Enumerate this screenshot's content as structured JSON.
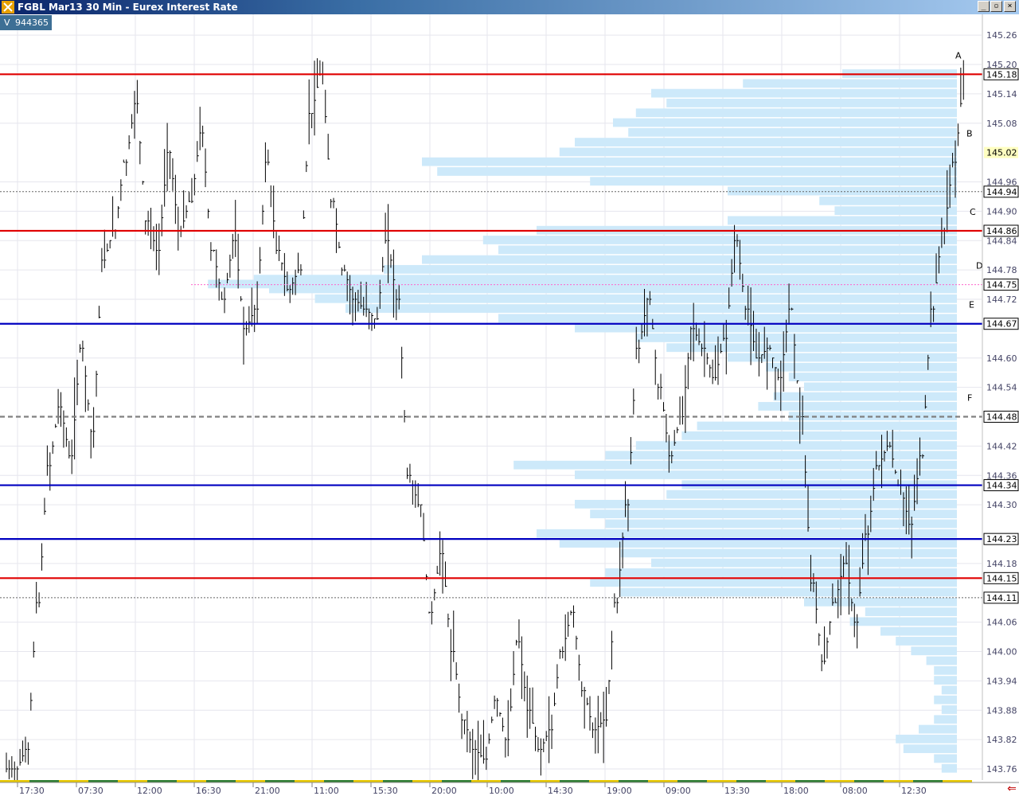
{
  "window": {
    "title": "FGBL Mar13 30 Min - Eurex Interest Rate",
    "buttons": [
      "_",
      "▫",
      "×"
    ]
  },
  "volume": {
    "label": "V",
    "value": "944365"
  },
  "colors": {
    "profile": "#cde9fa",
    "red_line": "#e00000",
    "blue_line": "#0000c0",
    "magenta_line": "#ff66cc",
    "bars": "#000000",
    "grid": "#e6e6ee",
    "session_green": "#2e7d32",
    "session_yellow": "#e8c800",
    "scroll_arrow": "#c00000"
  },
  "chart_data": {
    "type": "bar",
    "instrument": "FGBL Mar13",
    "interval": "30 Min",
    "ylim": [
      143.73,
      145.3
    ],
    "y_ticks": [
      "145.26",
      "145.20",
      "145.14",
      "145.08",
      "144.96",
      "144.90",
      "144.84",
      "144.78",
      "144.72",
      "144.60",
      "144.54",
      "144.42",
      "144.36",
      "144.30",
      "144.18",
      "144.06",
      "144.00",
      "143.94",
      "143.88",
      "143.82",
      "143.76"
    ],
    "x_ticks": [
      "17:30",
      "07:30",
      "12:00",
      "16:30",
      "21:00",
      "11:00",
      "15:30",
      "20:00",
      "10:00",
      "14:30",
      "19:00",
      "09:00",
      "13:30",
      "18:00",
      "08:00",
      "12:30"
    ],
    "price_series": {
      "name": "FGBL close",
      "values": [
        143.76,
        143.8,
        144.1,
        144.38,
        144.5,
        144.4,
        144.62,
        144.45,
        144.8,
        144.86,
        145.0,
        145.12,
        144.88,
        144.82,
        145.02,
        144.86,
        144.92,
        145.06,
        144.82,
        144.72,
        144.84,
        144.66,
        144.7,
        145.0,
        144.82,
        144.74,
        144.78,
        145.1,
        145.18,
        144.92,
        144.78,
        144.72,
        144.7,
        144.68,
        144.84,
        144.72,
        144.36,
        144.3,
        144.08,
        144.2,
        144.0,
        143.86,
        143.8,
        143.78,
        143.9,
        143.82,
        144.02,
        143.88,
        143.8,
        143.84,
        144.0,
        144.08,
        143.92,
        143.84,
        143.86,
        144.1,
        144.3,
        144.62,
        144.72,
        144.54,
        144.4,
        144.48,
        144.66,
        144.62,
        144.56,
        144.64,
        144.84,
        144.7,
        144.6,
        144.62,
        144.56,
        144.7,
        144.48,
        144.14,
        143.98,
        144.1,
        144.18,
        144.06,
        144.24,
        144.38,
        144.42,
        144.34,
        144.26,
        144.4,
        144.7,
        144.86,
        145.0,
        145.18
      ]
    },
    "profile": {
      "description": "volume-at-price histogram, relative length 0..1 per 0.01 price level",
      "levels": [
        {
          "price": 145.18,
          "rel": 0.15
        },
        {
          "price": 145.16,
          "rel": 0.28
        },
        {
          "price": 145.14,
          "rel": 0.4
        },
        {
          "price": 145.12,
          "rel": 0.38
        },
        {
          "price": 145.1,
          "rel": 0.42
        },
        {
          "price": 145.08,
          "rel": 0.45
        },
        {
          "price": 145.06,
          "rel": 0.43
        },
        {
          "price": 145.04,
          "rel": 0.5
        },
        {
          "price": 145.02,
          "rel": 0.52
        },
        {
          "price": 145.0,
          "rel": 0.7
        },
        {
          "price": 144.98,
          "rel": 0.68
        },
        {
          "price": 144.96,
          "rel": 0.48
        },
        {
          "price": 144.94,
          "rel": 0.3
        },
        {
          "price": 144.92,
          "rel": 0.18
        },
        {
          "price": 144.9,
          "rel": 0.16
        },
        {
          "price": 144.88,
          "rel": 0.3
        },
        {
          "price": 144.86,
          "rel": 0.55
        },
        {
          "price": 144.84,
          "rel": 0.62
        },
        {
          "price": 144.82,
          "rel": 0.6
        },
        {
          "price": 144.8,
          "rel": 0.7
        },
        {
          "price": 144.78,
          "rel": 0.75
        },
        {
          "price": 144.76,
          "rel": 0.92
        },
        {
          "price": 144.75,
          "rel": 0.98
        },
        {
          "price": 144.74,
          "rel": 0.9
        },
        {
          "price": 144.72,
          "rel": 0.84
        },
        {
          "price": 144.7,
          "rel": 0.8
        },
        {
          "price": 144.68,
          "rel": 0.6
        },
        {
          "price": 144.66,
          "rel": 0.5
        },
        {
          "price": 144.64,
          "rel": 0.42
        },
        {
          "price": 144.62,
          "rel": 0.38
        },
        {
          "price": 144.6,
          "rel": 0.3
        },
        {
          "price": 144.58,
          "rel": 0.25
        },
        {
          "price": 144.56,
          "rel": 0.22
        },
        {
          "price": 144.54,
          "rel": 0.2
        },
        {
          "price": 144.52,
          "rel": 0.24
        },
        {
          "price": 144.5,
          "rel": 0.26
        },
        {
          "price": 144.48,
          "rel": 0.22
        },
        {
          "price": 144.46,
          "rel": 0.34
        },
        {
          "price": 144.44,
          "rel": 0.36
        },
        {
          "price": 144.42,
          "rel": 0.42
        },
        {
          "price": 144.4,
          "rel": 0.46
        },
        {
          "price": 144.38,
          "rel": 0.58
        },
        {
          "price": 144.36,
          "rel": 0.5
        },
        {
          "price": 144.34,
          "rel": 0.36
        },
        {
          "price": 144.32,
          "rel": 0.38
        },
        {
          "price": 144.3,
          "rel": 0.5
        },
        {
          "price": 144.28,
          "rel": 0.48
        },
        {
          "price": 144.26,
          "rel": 0.46
        },
        {
          "price": 144.24,
          "rel": 0.55
        },
        {
          "price": 144.22,
          "rel": 0.52
        },
        {
          "price": 144.2,
          "rel": 0.44
        },
        {
          "price": 144.18,
          "rel": 0.4
        },
        {
          "price": 144.16,
          "rel": 0.46
        },
        {
          "price": 144.14,
          "rel": 0.48
        },
        {
          "price": 144.12,
          "rel": 0.44
        },
        {
          "price": 144.1,
          "rel": 0.2
        },
        {
          "price": 144.08,
          "rel": 0.12
        },
        {
          "price": 144.06,
          "rel": 0.14
        },
        {
          "price": 144.04,
          "rel": 0.1
        },
        {
          "price": 144.02,
          "rel": 0.08
        },
        {
          "price": 144.0,
          "rel": 0.06
        },
        {
          "price": 143.98,
          "rel": 0.04
        },
        {
          "price": 143.96,
          "rel": 0.03
        },
        {
          "price": 143.94,
          "rel": 0.03
        },
        {
          "price": 143.92,
          "rel": 0.02
        },
        {
          "price": 143.9,
          "rel": 0.03
        },
        {
          "price": 143.88,
          "rel": 0.02
        },
        {
          "price": 143.86,
          "rel": 0.03
        },
        {
          "price": 143.84,
          "rel": 0.05
        },
        {
          "price": 143.82,
          "rel": 0.08
        },
        {
          "price": 143.8,
          "rel": 0.07
        },
        {
          "price": 143.78,
          "rel": 0.03
        },
        {
          "price": 143.76,
          "rel": 0.02
        }
      ]
    },
    "levels": [
      {
        "price": 145.18,
        "label": "145.18",
        "color": "#e00000",
        "style": "solid",
        "letter": "A"
      },
      {
        "price": 145.02,
        "label": "145.02",
        "color": "none",
        "style": "highlight",
        "letter": "B"
      },
      {
        "price": 144.94,
        "label": "144.94",
        "color": "#666666",
        "style": "dotted",
        "letter": ""
      },
      {
        "price": 144.86,
        "label": "144.86",
        "color": "#e00000",
        "style": "solid",
        "letter": "C"
      },
      {
        "price": 144.75,
        "label": "144.75",
        "color": "#ff66cc",
        "style": "dotted",
        "letter": "D"
      },
      {
        "price": 144.67,
        "label": "144.67",
        "color": "#0000c0",
        "style": "solid",
        "letter": "E"
      },
      {
        "price": 144.48,
        "label": "144.48",
        "color": "#808080",
        "style": "dashed",
        "letter": "F"
      },
      {
        "price": 144.34,
        "label": "144.34",
        "color": "#0000c0",
        "style": "solid",
        "letter": ""
      },
      {
        "price": 144.23,
        "label": "144.23",
        "color": "#0000c0",
        "style": "solid",
        "letter": ""
      },
      {
        "price": 144.15,
        "label": "144.15",
        "color": "#e00000",
        "style": "solid",
        "letter": ""
      },
      {
        "price": 144.11,
        "label": "144.11",
        "color": "#666666",
        "style": "dotted",
        "letter": ""
      }
    ]
  }
}
